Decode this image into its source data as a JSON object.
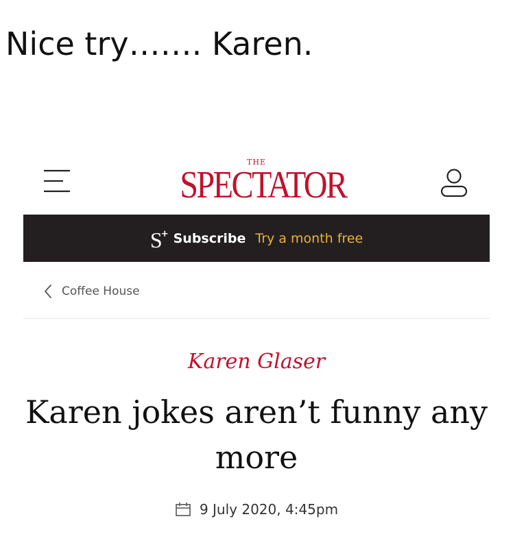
{
  "caption": "Nice try……. Karen.",
  "header": {
    "logo_small": "THE",
    "logo_main": "SPECTATOR",
    "menu_icon": "hamburger-menu-icon",
    "account_icon": "user-account-icon"
  },
  "subscribe_bar": {
    "logo_letter": "S",
    "logo_plus": "+",
    "label": "Subscribe",
    "offer": "Try a month free"
  },
  "breadcrumb": {
    "label": "Coffee House",
    "icon": "chevron-left-icon"
  },
  "article": {
    "author": "Karen Glaser",
    "headline": "Karen jokes aren’t funny any more",
    "date": "9 July 2020, 4:45pm",
    "date_icon": "calendar-icon"
  },
  "colors": {
    "brand_red": "#c0122c",
    "bar_dark": "#231f20",
    "offer_gold": "#e8b43a"
  }
}
